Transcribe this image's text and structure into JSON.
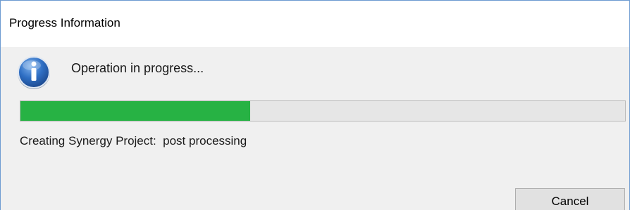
{
  "window": {
    "title": "Progress Information"
  },
  "message": {
    "icon": "info-icon",
    "text": "Operation in progress..."
  },
  "progress": {
    "fraction": 0.38,
    "fill_color": "#27b244",
    "status": "Creating Synergy Project:  post processing"
  },
  "buttons": {
    "cancel_label": "Cancel"
  }
}
